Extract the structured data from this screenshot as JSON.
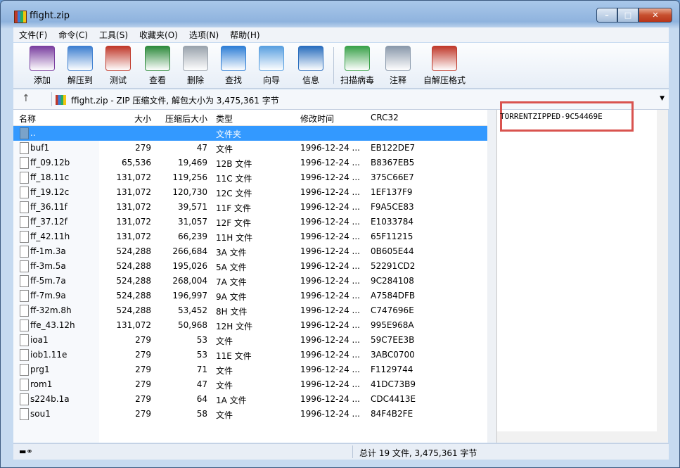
{
  "window": {
    "title": "ffight.zip"
  },
  "menu": [
    "文件(F)",
    "命令(C)",
    "工具(S)",
    "收藏夹(O)",
    "选项(N)",
    "帮助(H)"
  ],
  "toolbar": [
    {
      "label": "添加",
      "icon": "winrar-books-icon",
      "color": "#7a3fa0"
    },
    {
      "label": "解压到",
      "icon": "folder-icon",
      "color": "#3d7fd0"
    },
    {
      "label": "测试",
      "icon": "clipboard-check-icon",
      "color": "#c0392b"
    },
    {
      "label": "查看",
      "icon": "open-book-icon",
      "color": "#2e8b3d"
    },
    {
      "label": "删除",
      "icon": "trash-can-icon",
      "color": "#9aa3ad"
    },
    {
      "label": "查找",
      "icon": "magnifier-icon",
      "color": "#2f7fd6"
    },
    {
      "label": "向导",
      "icon": "magic-wand-icon",
      "color": "#5aa0e0"
    },
    {
      "label": "信息",
      "icon": "info-icon",
      "color": "#2a6ebe"
    },
    {
      "label": "扫描病毒",
      "icon": "virus-scan-icon",
      "color": "#3aa24a"
    },
    {
      "label": "注释",
      "icon": "note-icon",
      "color": "#8a99ab"
    },
    {
      "label": "自解压格式",
      "icon": "sfx-archive-icon",
      "color": "#c0392b"
    }
  ],
  "address": {
    "text": "ffight.zip - ZIP 压缩文件, 解包大小为 3,475,361 字节"
  },
  "columns": {
    "name": "名称",
    "size": "大小",
    "packed": "压缩后大小",
    "type": "类型",
    "modified": "修改时间",
    "crc": "CRC32"
  },
  "files": [
    {
      "name": "..",
      "size": "",
      "packed": "",
      "type": "文件夹",
      "modified": "",
      "crc": ""
    },
    {
      "name": "buf1",
      "size": "279",
      "packed": "47",
      "type": "文件",
      "modified": "1996-12-24 ...",
      "crc": "EB122DE7"
    },
    {
      "name": "ff_09.12b",
      "size": "65,536",
      "packed": "19,469",
      "type": "12B 文件",
      "modified": "1996-12-24 ...",
      "crc": "B8367EB5"
    },
    {
      "name": "ff_18.11c",
      "size": "131,072",
      "packed": "119,256",
      "type": "11C 文件",
      "modified": "1996-12-24 ...",
      "crc": "375C66E7"
    },
    {
      "name": "ff_19.12c",
      "size": "131,072",
      "packed": "120,730",
      "type": "12C 文件",
      "modified": "1996-12-24 ...",
      "crc": "1EF137F9"
    },
    {
      "name": "ff_36.11f",
      "size": "131,072",
      "packed": "39,571",
      "type": "11F 文件",
      "modified": "1996-12-24 ...",
      "crc": "F9A5CE83"
    },
    {
      "name": "ff_37.12f",
      "size": "131,072",
      "packed": "31,057",
      "type": "12F 文件",
      "modified": "1996-12-24 ...",
      "crc": "E1033784"
    },
    {
      "name": "ff_42.11h",
      "size": "131,072",
      "packed": "66,239",
      "type": "11H 文件",
      "modified": "1996-12-24 ...",
      "crc": "65F11215"
    },
    {
      "name": "ff-1m.3a",
      "size": "524,288",
      "packed": "266,684",
      "type": "3A 文件",
      "modified": "1996-12-24 ...",
      "crc": "0B605E44"
    },
    {
      "name": "ff-3m.5a",
      "size": "524,288",
      "packed": "195,026",
      "type": "5A 文件",
      "modified": "1996-12-24 ...",
      "crc": "52291CD2"
    },
    {
      "name": "ff-5m.7a",
      "size": "524,288",
      "packed": "268,004",
      "type": "7A 文件",
      "modified": "1996-12-24 ...",
      "crc": "9C284108"
    },
    {
      "name": "ff-7m.9a",
      "size": "524,288",
      "packed": "196,997",
      "type": "9A 文件",
      "modified": "1996-12-24 ...",
      "crc": "A7584DFB"
    },
    {
      "name": "ff-32m.8h",
      "size": "524,288",
      "packed": "53,452",
      "type": "8H 文件",
      "modified": "1996-12-24 ...",
      "crc": "C747696E"
    },
    {
      "name": "ffe_43.12h",
      "size": "131,072",
      "packed": "50,968",
      "type": "12H 文件",
      "modified": "1996-12-24 ...",
      "crc": "995E968A"
    },
    {
      "name": "ioa1",
      "size": "279",
      "packed": "53",
      "type": "文件",
      "modified": "1996-12-24 ...",
      "crc": "59C7EE3B"
    },
    {
      "name": "iob1.11e",
      "size": "279",
      "packed": "53",
      "type": "11E 文件",
      "modified": "1996-12-24 ...",
      "crc": "3ABC0700"
    },
    {
      "name": "prg1",
      "size": "279",
      "packed": "71",
      "type": "文件",
      "modified": "1996-12-24 ...",
      "crc": "F1129744"
    },
    {
      "name": "rom1",
      "size": "279",
      "packed": "47",
      "type": "文件",
      "modified": "1996-12-24 ...",
      "crc": "41DC73B9"
    },
    {
      "name": "s224b.1a",
      "size": "279",
      "packed": "64",
      "type": "1A 文件",
      "modified": "1996-12-24 ...",
      "crc": "CDC4413E"
    },
    {
      "name": "sou1",
      "size": "279",
      "packed": "58",
      "type": "文件",
      "modified": "1996-12-24 ...",
      "crc": "84F4B2FE"
    }
  ],
  "comment": {
    "text": "TORRENTZIPPED-9C54469E",
    "highlight_color": "#d9534f"
  },
  "status": {
    "text": "总计 19 文件, 3,475,361 字节"
  }
}
